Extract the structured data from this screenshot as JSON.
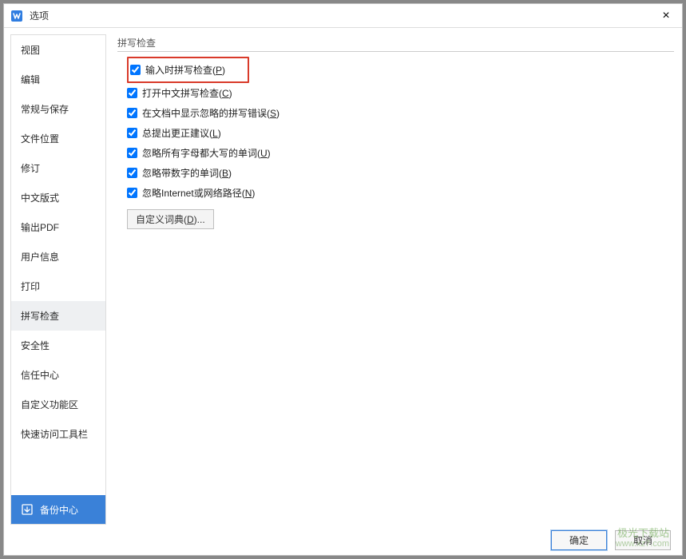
{
  "title": "选项",
  "close_label": "×",
  "sidebar": {
    "items": [
      {
        "label": "视图"
      },
      {
        "label": "编辑"
      },
      {
        "label": "常规与保存"
      },
      {
        "label": "文件位置"
      },
      {
        "label": "修订"
      },
      {
        "label": "中文版式"
      },
      {
        "label": "输出PDF"
      },
      {
        "label": "用户信息"
      },
      {
        "label": "打印"
      },
      {
        "label": "拼写检查"
      },
      {
        "label": "安全性"
      },
      {
        "label": "信任中心"
      },
      {
        "label": "自定义功能区"
      },
      {
        "label": "快速访问工具栏"
      }
    ],
    "selected_index": 9,
    "backup_center": "备份中心"
  },
  "content": {
    "group_label": "拼写检查",
    "checks": [
      {
        "label": "输入时拼写检查(",
        "key": "P",
        "tail": ")",
        "checked": true,
        "highlighted": true
      },
      {
        "label": "打开中文拼写检查(",
        "key": "C",
        "tail": ")",
        "checked": true,
        "highlighted": false
      },
      {
        "label": "在文档中显示忽略的拼写错误(",
        "key": "S",
        "tail": ")",
        "checked": true,
        "highlighted": false
      },
      {
        "label": "总提出更正建议(",
        "key": "L",
        "tail": ")",
        "checked": true,
        "highlighted": false
      },
      {
        "label": "忽略所有字母都大写的单词(",
        "key": "U",
        "tail": ")",
        "checked": true,
        "highlighted": false
      },
      {
        "label": "忽略带数字的单词(",
        "key": "B",
        "tail": ")",
        "checked": true,
        "highlighted": false
      },
      {
        "label": "忽略Internet或网络路径(",
        "key": "N",
        "tail": ")",
        "checked": true,
        "highlighted": false
      }
    ],
    "custom_dict_label": "自定义词典(",
    "custom_dict_key": "D",
    "custom_dict_tail": ")..."
  },
  "footer": {
    "ok": "确定",
    "cancel": "取消"
  },
  "watermark": {
    "line1": "极光下载站",
    "line2": "www.xz7.com"
  }
}
